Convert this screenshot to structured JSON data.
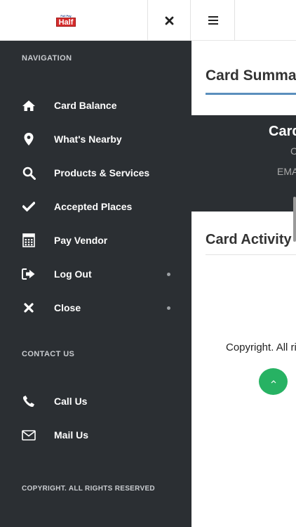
{
  "header": {
    "logo_top_text": "Full Pay",
    "logo_text": "Half"
  },
  "main": {
    "summary_title": "Card Summary",
    "card_name": "Card",
    "card_line2": "C",
    "card_line3": "EMAIL",
    "activity_title": "Card Activity",
    "copyright": "Copyright. All rights reserved"
  },
  "drawer": {
    "nav_heading": "NAVIGATION",
    "nav_items": [
      {
        "label": "Card Balance",
        "icon": "home-icon"
      },
      {
        "label": "What's Nearby",
        "icon": "map-marker-icon"
      },
      {
        "label": "Products & Services",
        "icon": "search-icon"
      },
      {
        "label": "Accepted Places",
        "icon": "check-icon"
      },
      {
        "label": "Pay Vendor",
        "icon": "calculator-icon"
      },
      {
        "label": "Log Out",
        "icon": "sign-out-icon"
      },
      {
        "label": "Close",
        "icon": "close-icon"
      }
    ],
    "contact_heading": "CONTACT US",
    "contact_items": [
      {
        "label": "Call Us",
        "icon": "phone-icon"
      },
      {
        "label": "Mail Us",
        "icon": "envelope-icon"
      }
    ],
    "copyright": "COPYRIGHT. ALL RIGHTS RESERVED"
  },
  "colors": {
    "drawer_bg": "#2b2f33",
    "accent_blue": "#5b8fbd",
    "scroll_top_green": "#27b263"
  }
}
